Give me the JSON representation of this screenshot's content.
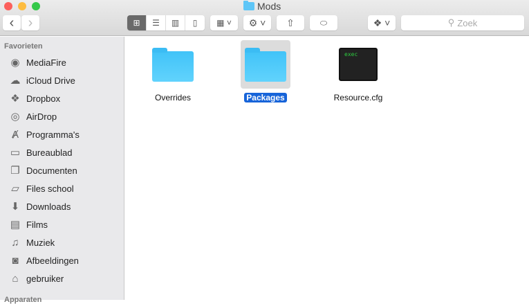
{
  "window": {
    "title": "Mods",
    "colors": {
      "close": "#fc605c",
      "minimize": "#fdbc40",
      "zoom": "#34c84a"
    }
  },
  "toolbar": {
    "back": "‹",
    "forward": "›",
    "search_placeholder": "Zoek"
  },
  "sidebar": {
    "favorites_heading": "Favorieten",
    "devices_heading": "Apparaten",
    "items": [
      {
        "label": "MediaFire",
        "icon": "mediafire-icon",
        "glyph": "◉"
      },
      {
        "label": "iCloud Drive",
        "icon": "cloud-icon",
        "glyph": "☁"
      },
      {
        "label": "Dropbox",
        "icon": "dropbox-icon",
        "glyph": "❖"
      },
      {
        "label": "AirDrop",
        "icon": "airdrop-icon",
        "glyph": "◎"
      },
      {
        "label": "Programma's",
        "icon": "applications-icon",
        "glyph": "Ⱥ"
      },
      {
        "label": "Bureaublad",
        "icon": "desktop-icon",
        "glyph": "▭"
      },
      {
        "label": "Documenten",
        "icon": "documents-icon",
        "glyph": "❐"
      },
      {
        "label": "Files school",
        "icon": "folder-icon",
        "glyph": "▱"
      },
      {
        "label": "Downloads",
        "icon": "downloads-icon",
        "glyph": "⬇"
      },
      {
        "label": "Films",
        "icon": "film-icon",
        "glyph": "▤"
      },
      {
        "label": "Muziek",
        "icon": "music-icon",
        "glyph": "♫"
      },
      {
        "label": "Afbeeldingen",
        "icon": "camera-icon",
        "glyph": "◙"
      },
      {
        "label": "gebruiker",
        "icon": "home-icon",
        "glyph": "⌂"
      }
    ]
  },
  "files": [
    {
      "name": "Overrides",
      "type": "folder"
    },
    {
      "name": "Packages",
      "type": "folder",
      "selected": true
    },
    {
      "name": "Resource.cfg",
      "type": "terminal",
      "preview": "exec"
    }
  ]
}
